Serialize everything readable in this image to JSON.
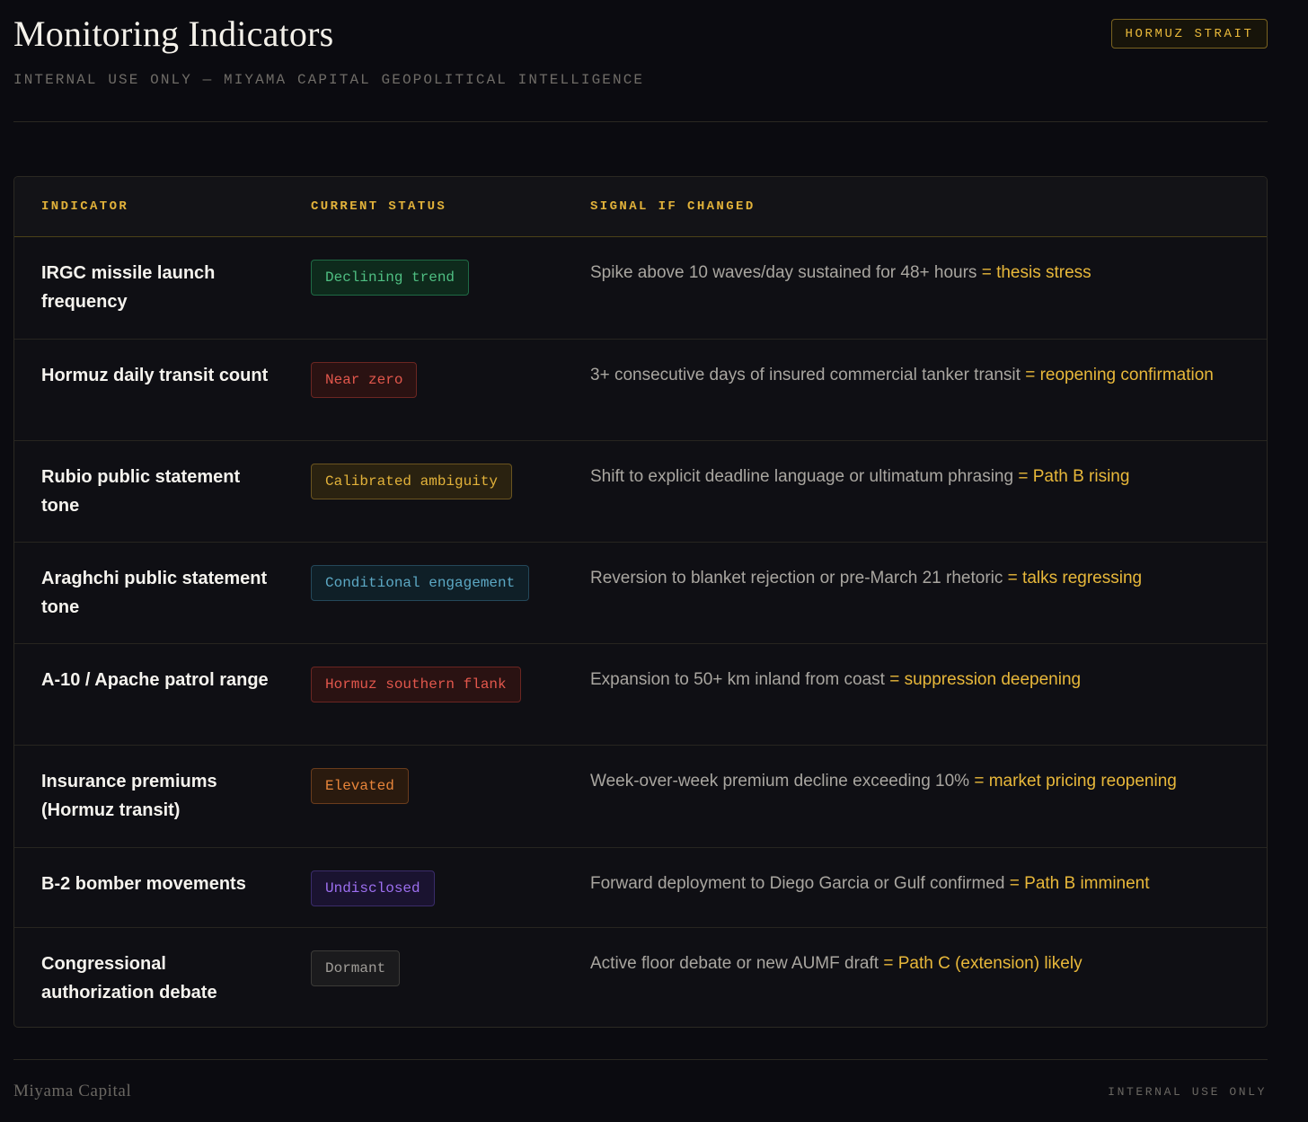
{
  "header": {
    "title": "Monitoring Indicators",
    "subtitle": "INTERNAL USE ONLY — MIYAMA CAPITAL GEOPOLITICAL INTELLIGENCE",
    "region_badge": "HORMUZ STRAIT"
  },
  "table": {
    "columns": [
      "INDICATOR",
      "CURRENT STATUS",
      "SIGNAL IF CHANGED"
    ],
    "rows": [
      {
        "indicator": "IRGC missile launch frequency",
        "status": "Declining trend",
        "status_colors": {
          "text": "#4fbf82",
          "border": "#1f6a45",
          "bg": "#0e2a1c"
        },
        "signal": "Spike above 10 waves/day sustained for 48+ hours",
        "signal_emphasis": "= thesis stress"
      },
      {
        "indicator": "Hormuz daily transit count",
        "status": "Near zero",
        "status_colors": {
          "text": "#e2574c",
          "border": "#6b2622",
          "bg": "#2a1212"
        },
        "signal": "3+ consecutive days of insured commercial tanker transit",
        "signal_emphasis": "= reopening confirmation"
      },
      {
        "indicator": "Rubio public statement tone",
        "status": "Calibrated ambiguity",
        "status_colors": {
          "text": "#e2b23a",
          "border": "#6a5420",
          "bg": "#2a2210"
        },
        "signal": "Shift to explicit deadline language or ultimatum phrasing",
        "signal_emphasis": "= Path B rising"
      },
      {
        "indicator": "Araghchi public statement tone",
        "status": "Conditional engagement",
        "status_colors": {
          "text": "#5ca8c4",
          "border": "#24485a",
          "bg": "#0f1f27"
        },
        "signal": "Reversion to blanket rejection or pre-March 21 rhetoric",
        "signal_emphasis": "= talks regressing"
      },
      {
        "indicator": "A-10 / Apache patrol range",
        "status": "Hormuz southern flank",
        "status_colors": {
          "text": "#e2574c",
          "border": "#6b2622",
          "bg": "#2a1212"
        },
        "signal": "Expansion to 50+ km inland from coast",
        "signal_emphasis": "= suppression deepening"
      },
      {
        "indicator": "Insurance premiums (Hormuz transit)",
        "status": "Elevated",
        "status_colors": {
          "text": "#e8853a",
          "border": "#6a3c1c",
          "bg": "#2a1a0e"
        },
        "signal": "Week-over-week premium decline exceeding 10%",
        "signal_emphasis": "= market pricing reopening"
      },
      {
        "indicator": "B-2 bomber movements",
        "status": "Undisclosed",
        "status_colors": {
          "text": "#9d6ff0",
          "border": "#3a2c6a",
          "bg": "#1a1330"
        },
        "signal": "Forward deployment to Diego Garcia or Gulf confirmed",
        "signal_emphasis": "= Path B imminent"
      },
      {
        "indicator": "Congressional authorization debate",
        "status": "Dormant",
        "status_colors": {
          "text": "#a09d98",
          "border": "#3c3b38",
          "bg": "#1b1b1d"
        },
        "signal": "Active floor debate or new AUMF draft",
        "signal_emphasis": "= Path C (extension) likely"
      }
    ]
  },
  "footer": {
    "brand": "Miyama Capital",
    "note": "INTERNAL USE ONLY"
  }
}
